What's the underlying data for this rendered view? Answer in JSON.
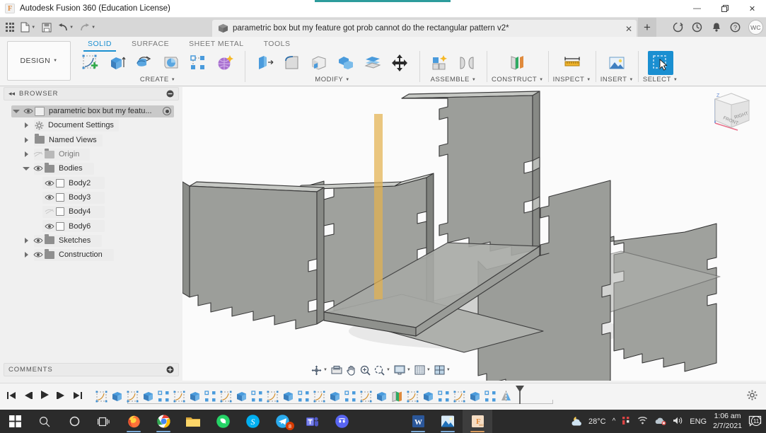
{
  "window": {
    "app_title": "Autodesk Fusion 360 (Education License)",
    "app_icon": "fusion-logo-icon",
    "minimize": "—",
    "maximize": "❐",
    "close": "✕"
  },
  "quick_access": {
    "items": [
      {
        "name": "data-panel-grid-icon",
        "label": ""
      },
      {
        "name": "file-menu-icon",
        "label": ""
      },
      {
        "name": "save-icon",
        "label": ""
      },
      {
        "name": "undo-icon",
        "label": ""
      },
      {
        "name": "redo-icon",
        "label": ""
      }
    ]
  },
  "document_tab": {
    "title": "parametric box but my feature got prob cannot do the rectangular pattern v2*",
    "close_label": "✕",
    "new_tab_label": "+"
  },
  "top_right_icons": [
    {
      "name": "sync-icon",
      "glyph": "↻"
    },
    {
      "name": "recent-clock-icon",
      "glyph": "◔"
    },
    {
      "name": "notifications-bell-icon",
      "glyph": "🔔"
    },
    {
      "name": "help-icon",
      "glyph": "?"
    }
  ],
  "account": {
    "initials": "WC"
  },
  "ribbon": {
    "workspace": "DESIGN",
    "tabs": [
      {
        "label": "SOLID",
        "active": true
      },
      {
        "label": "SURFACE",
        "active": false
      },
      {
        "label": "SHEET METAL",
        "active": false
      },
      {
        "label": "TOOLS",
        "active": false
      }
    ],
    "panels": [
      {
        "label": "CREATE",
        "has_dropdown": true,
        "tools": [
          "create-sketch-icon",
          "extrude-icon",
          "revolve-icon",
          "sweep-icon",
          "pattern-icon",
          "form-icon"
        ]
      },
      {
        "label": "MODIFY",
        "has_dropdown": true,
        "tools": [
          "press-pull-icon",
          "fillet-icon",
          "shell-icon",
          "combine-icon",
          "offset-face-icon",
          "move-copy-icon"
        ]
      },
      {
        "label": "ASSEMBLE",
        "has_dropdown": true,
        "tools": [
          "new-component-icon",
          "joint-icon"
        ]
      },
      {
        "label": "CONSTRUCT",
        "has_dropdown": true,
        "tools": [
          "offset-plane-icon"
        ]
      },
      {
        "label": "INSPECT",
        "has_dropdown": true,
        "tools": [
          "measure-icon"
        ]
      },
      {
        "label": "INSERT",
        "has_dropdown": true,
        "tools": [
          "insert-image-icon"
        ]
      },
      {
        "label": "SELECT",
        "has_dropdown": true,
        "tools": [
          "select-window-icon"
        ]
      }
    ]
  },
  "browser": {
    "title": "BROWSER",
    "collapse_icon": "◂◂",
    "tree": [
      {
        "label": "parametric box but my featu...",
        "indent": 0,
        "expander": "open",
        "eye": "visible",
        "icon": "component-cube-icon",
        "selected": true,
        "activate": true
      },
      {
        "label": "Document Settings",
        "indent": 1,
        "expander": "closed",
        "eye": "none",
        "icon": "gear-icon"
      },
      {
        "label": "Named Views",
        "indent": 1,
        "expander": "closed",
        "eye": "none",
        "icon": "folder-icon"
      },
      {
        "label": "Origin",
        "indent": 1,
        "expander": "closed",
        "eye": "hidden",
        "icon": "folder-icon"
      },
      {
        "label": "Bodies",
        "indent": 1,
        "expander": "open",
        "eye": "visible",
        "icon": "folder-icon"
      },
      {
        "label": "Body2",
        "indent": 2,
        "expander": "none",
        "eye": "visible",
        "icon": "body-icon"
      },
      {
        "label": "Body3",
        "indent": 2,
        "expander": "none",
        "eye": "visible",
        "icon": "body-icon"
      },
      {
        "label": "Body4",
        "indent": 2,
        "expander": "none",
        "eye": "hidden",
        "icon": "body-icon"
      },
      {
        "label": "Body6",
        "indent": 2,
        "expander": "none",
        "eye": "visible",
        "icon": "body-icon"
      },
      {
        "label": "Sketches",
        "indent": 1,
        "expander": "closed",
        "eye": "visible",
        "icon": "folder-icon"
      },
      {
        "label": "Construction",
        "indent": 1,
        "expander": "closed",
        "eye": "visible",
        "icon": "folder-icon"
      }
    ]
  },
  "comments": {
    "title": "COMMENTS"
  },
  "viewcube": {
    "front_label": "FRONT",
    "right_label": "RIGHT",
    "z_axis_label": "Z",
    "axis_colors": {
      "x": "#e8708a",
      "y": "#8fbf6a",
      "z": "#6a8fd4"
    }
  },
  "canvas": {
    "model_name": "finger-jointed-box",
    "body_color": "#9a9c98",
    "plane_color": "#e0b24e",
    "background": "#fbfbfb"
  },
  "navbar": {
    "buttons": [
      {
        "name": "orbit-icon",
        "dropdown": true
      },
      {
        "name": "look-at-icon",
        "dropdown": false
      },
      {
        "name": "pan-icon",
        "dropdown": false
      },
      {
        "name": "zoom-icon",
        "dropdown": false
      },
      {
        "name": "fit-icon",
        "dropdown": true
      },
      {
        "name": "display-settings-icon",
        "dropdown": true
      },
      {
        "name": "grid-snaps-icon",
        "dropdown": true
      },
      {
        "name": "viewports-icon",
        "dropdown": true
      }
    ]
  },
  "timeline": {
    "playback": [
      {
        "name": "go-to-beginning-icon",
        "glyph": "⏮"
      },
      {
        "name": "step-back-icon",
        "glyph": "◀"
      },
      {
        "name": "play-icon",
        "glyph": "▶"
      },
      {
        "name": "step-forward-icon",
        "glyph": "▶"
      },
      {
        "name": "go-to-end-icon",
        "glyph": "⏭"
      }
    ],
    "features": [
      "sketch-icon",
      "extrude-icon",
      "sketch-icon",
      "extrude-icon",
      "pattern-icon",
      "sketch-icon",
      "extrude-icon",
      "pattern-icon",
      "sketch-icon",
      "extrude-icon",
      "pattern-icon",
      "sketch-icon",
      "extrude-icon",
      "pattern-icon",
      "sketch-icon",
      "extrude-icon",
      "pattern-icon",
      "sketch-icon",
      "extrude-icon",
      "construction-plane-icon",
      "sketch-icon",
      "extrude-icon",
      "pattern-icon",
      "sketch-icon",
      "extrude-icon",
      "pattern-icon",
      "mirror-icon"
    ],
    "settings_icon": "gear-icon"
  },
  "taskbar": {
    "left_icons": [
      {
        "name": "start-button",
        "label": "start-icon"
      },
      {
        "name": "search-icon",
        "label": "search"
      },
      {
        "name": "cortana-icon",
        "label": "cortana"
      },
      {
        "name": "task-view-icon",
        "label": "task-view"
      },
      {
        "name": "firefox-icon",
        "label": "Firefox"
      },
      {
        "name": "chrome-icon",
        "label": "Chrome"
      },
      {
        "name": "file-explorer-icon",
        "label": "File Explorer"
      },
      {
        "name": "whatsapp-icon",
        "label": "WhatsApp"
      },
      {
        "name": "skype-icon",
        "label": "Skype"
      },
      {
        "name": "telegram-icon",
        "label": "Telegram",
        "badge": "8"
      },
      {
        "name": "teams-icon",
        "label": "Microsoft Teams"
      },
      {
        "name": "discord-icon",
        "label": "Discord"
      },
      {
        "name": "word-icon",
        "label": "Word"
      },
      {
        "name": "photos-icon",
        "label": "Photos"
      },
      {
        "name": "fusion360-taskbar-icon",
        "label": "Fusion 360",
        "active": true
      }
    ],
    "weather": {
      "temp": "28°C",
      "icon": "partly-cloudy-night-icon"
    },
    "tray": [
      {
        "name": "show-hidden-icons",
        "glyph": "∧"
      },
      {
        "name": "tray-app-icon",
        "glyph": "❙"
      },
      {
        "name": "wifi-icon",
        "glyph": "◠"
      },
      {
        "name": "onedrive-icon",
        "glyph": "☁"
      },
      {
        "name": "volume-icon",
        "glyph": "🔊"
      }
    ],
    "language": "ENG",
    "time": "1:06 am",
    "date": "2/7/2021",
    "notifications_count": "11"
  }
}
